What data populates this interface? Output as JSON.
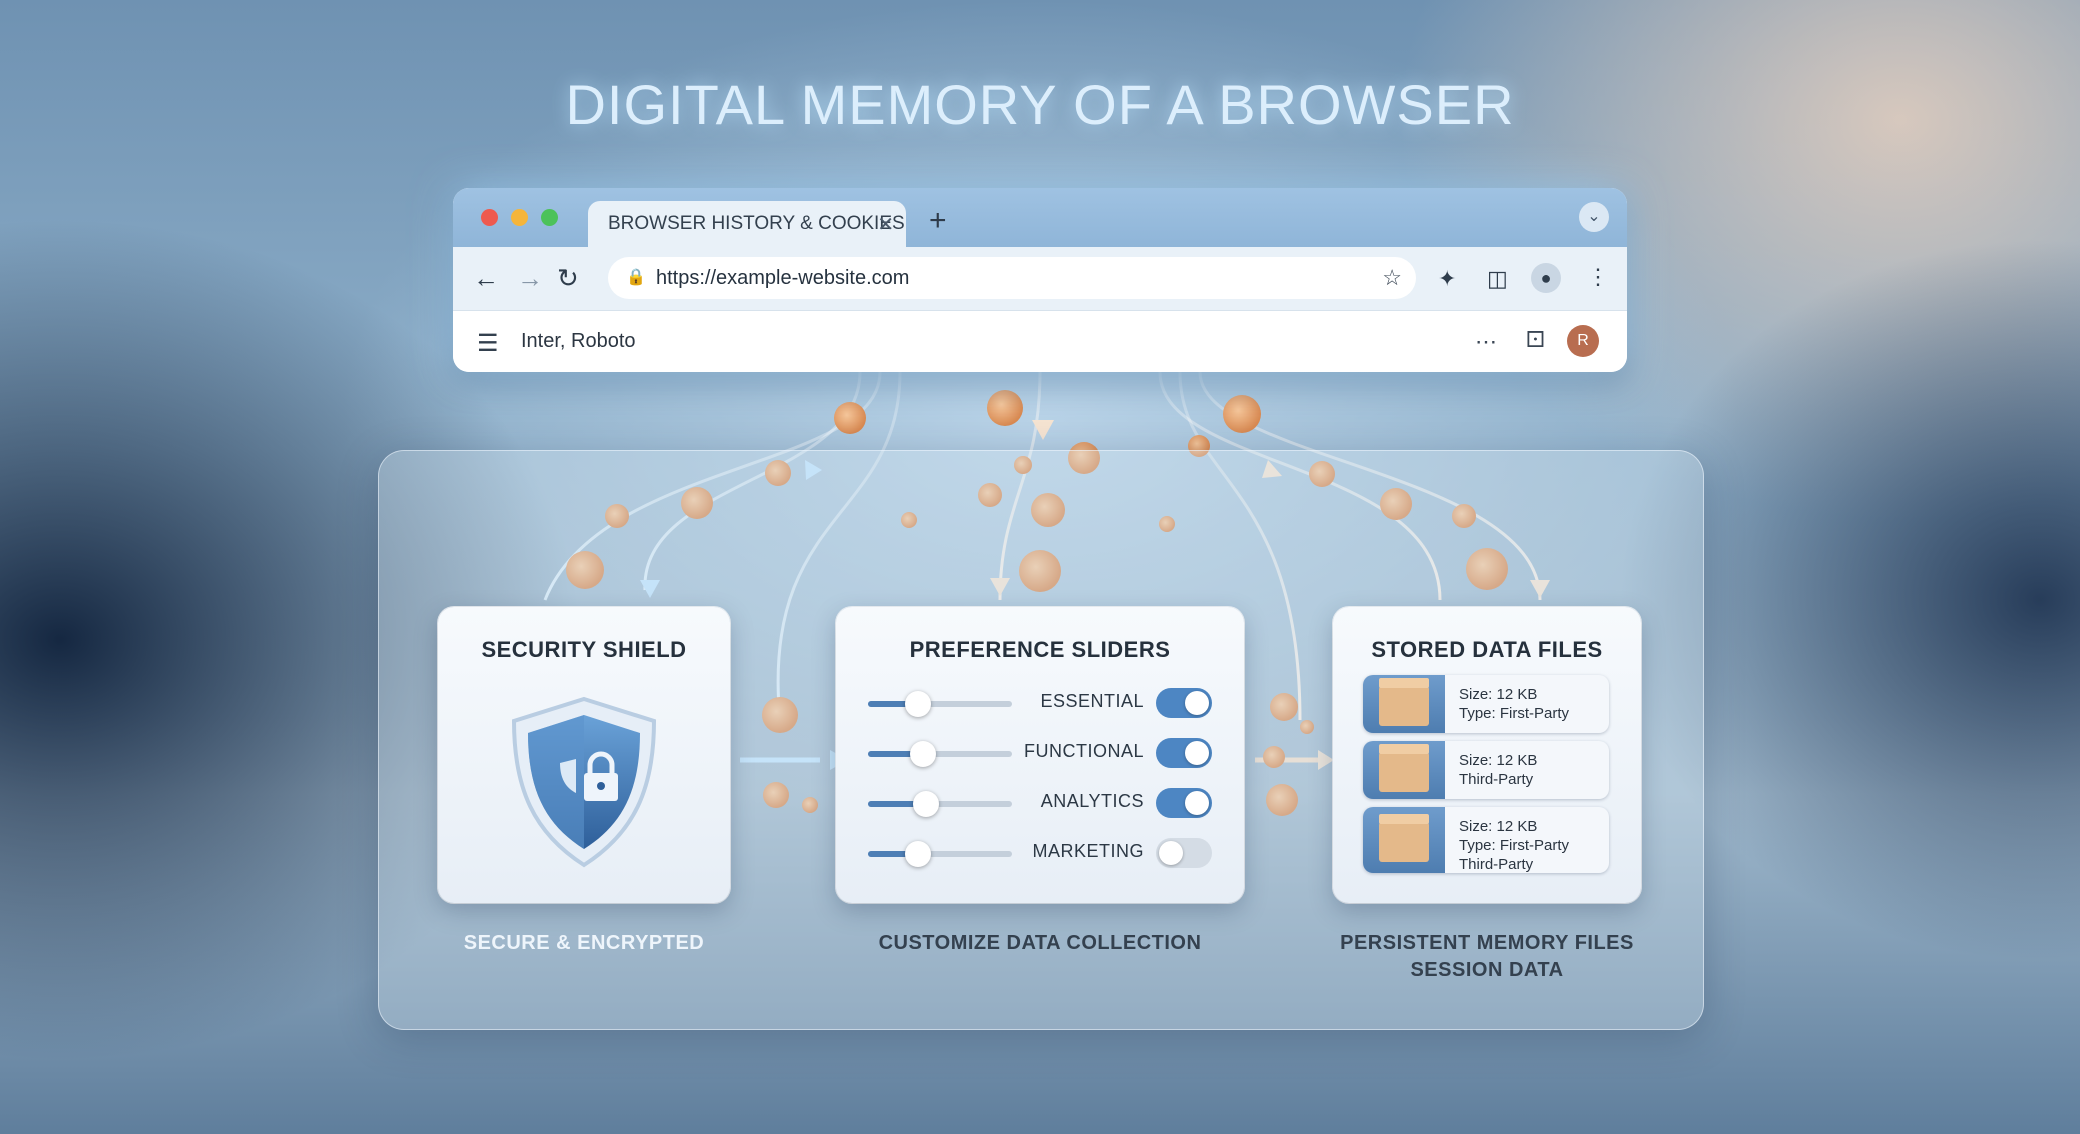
{
  "headline": "DIGITAL MEMORY OF A BROWSER",
  "browser": {
    "tab_title": "BROWSER HISTORY & COOKIES",
    "tab_close": "✕",
    "new_tab": "+",
    "url": "https://example-website.com",
    "toolbar_label": "Inter, Roboto",
    "avatar_initial": "R"
  },
  "panels": {
    "security": {
      "title": "SECURITY SHIELD",
      "caption": "SECURE & ENCRYPTED"
    },
    "preferences": {
      "title": "PREFERENCE SLIDERS",
      "caption": "CUSTOMIZE DATA COLLECTION",
      "rows": [
        {
          "label": "ESSENTIAL",
          "slider": 0.35,
          "enabled": true
        },
        {
          "label": "FUNCTIONAL",
          "slider": 0.38,
          "enabled": true
        },
        {
          "label": "ANALYTICS",
          "slider": 0.4,
          "enabled": true
        },
        {
          "label": "MARKETING",
          "slider": 0.35,
          "enabled": false
        }
      ]
    },
    "files": {
      "title": "STORED DATA FILES",
      "caption_line1": "PERSISTENT MEMORY FILES",
      "caption_line2": "SESSION DATA",
      "items": [
        {
          "size": "Size: 12 KB",
          "type1": "Type: First-Party",
          "type2": ""
        },
        {
          "size": "Size: 12 KB",
          "type1": "Third-Party",
          "type2": ""
        },
        {
          "size": "Size: 12 KB",
          "type1": "Type: First-Party",
          "type2": "Third-Party"
        }
      ]
    }
  },
  "colors": {
    "accent": "#4d86c3",
    "cookie": "#e9a56e",
    "shield": "#3f79b5"
  }
}
